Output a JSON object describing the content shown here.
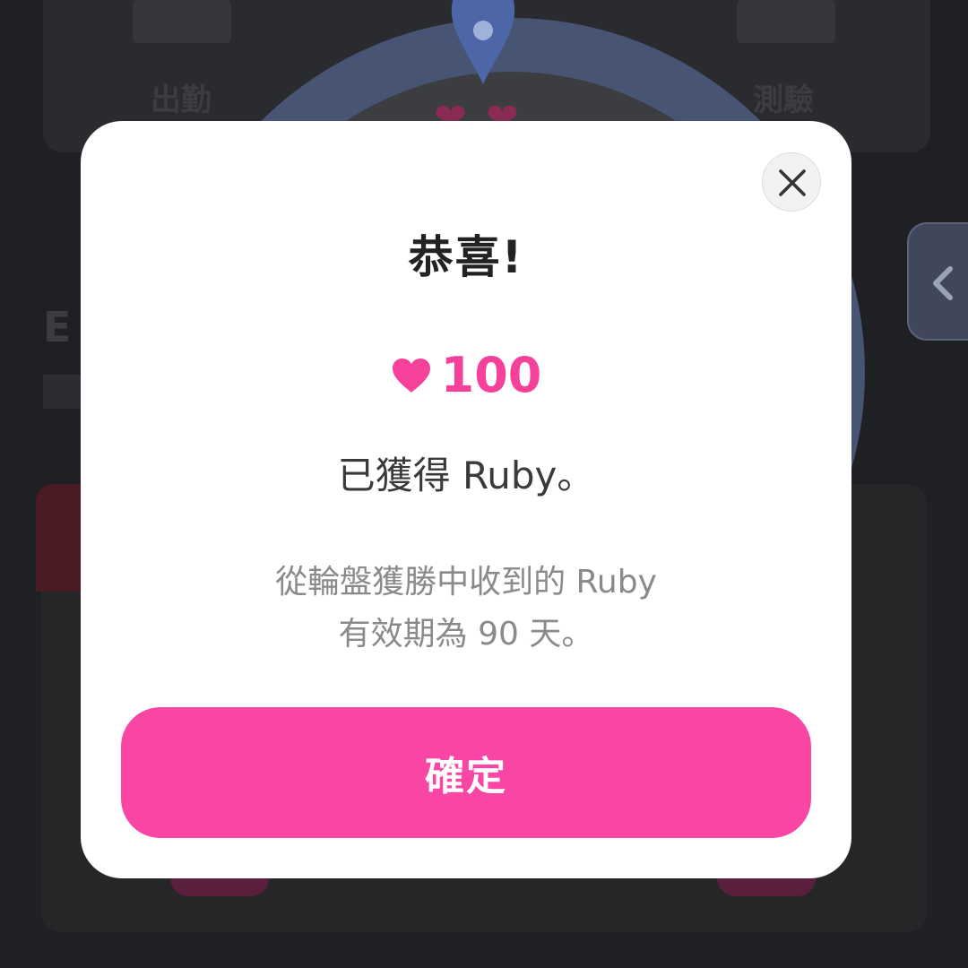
{
  "background": {
    "top_left_label": "出勤",
    "top_right_label": "測驗",
    "heading_fragment": "E"
  },
  "modal": {
    "title": "恭喜!",
    "reward": {
      "icon": "heart-icon",
      "amount": "100",
      "color": "#f5419a"
    },
    "message": "已獲得 Ruby。",
    "info_lines": [
      "從輪盤獲勝中收到的 Ruby",
      "有效期為 90 天。"
    ],
    "confirm_label": "確定",
    "close_icon": "close-icon"
  },
  "colors": {
    "accent": "#f946a5",
    "overlay": "#1f2023"
  }
}
